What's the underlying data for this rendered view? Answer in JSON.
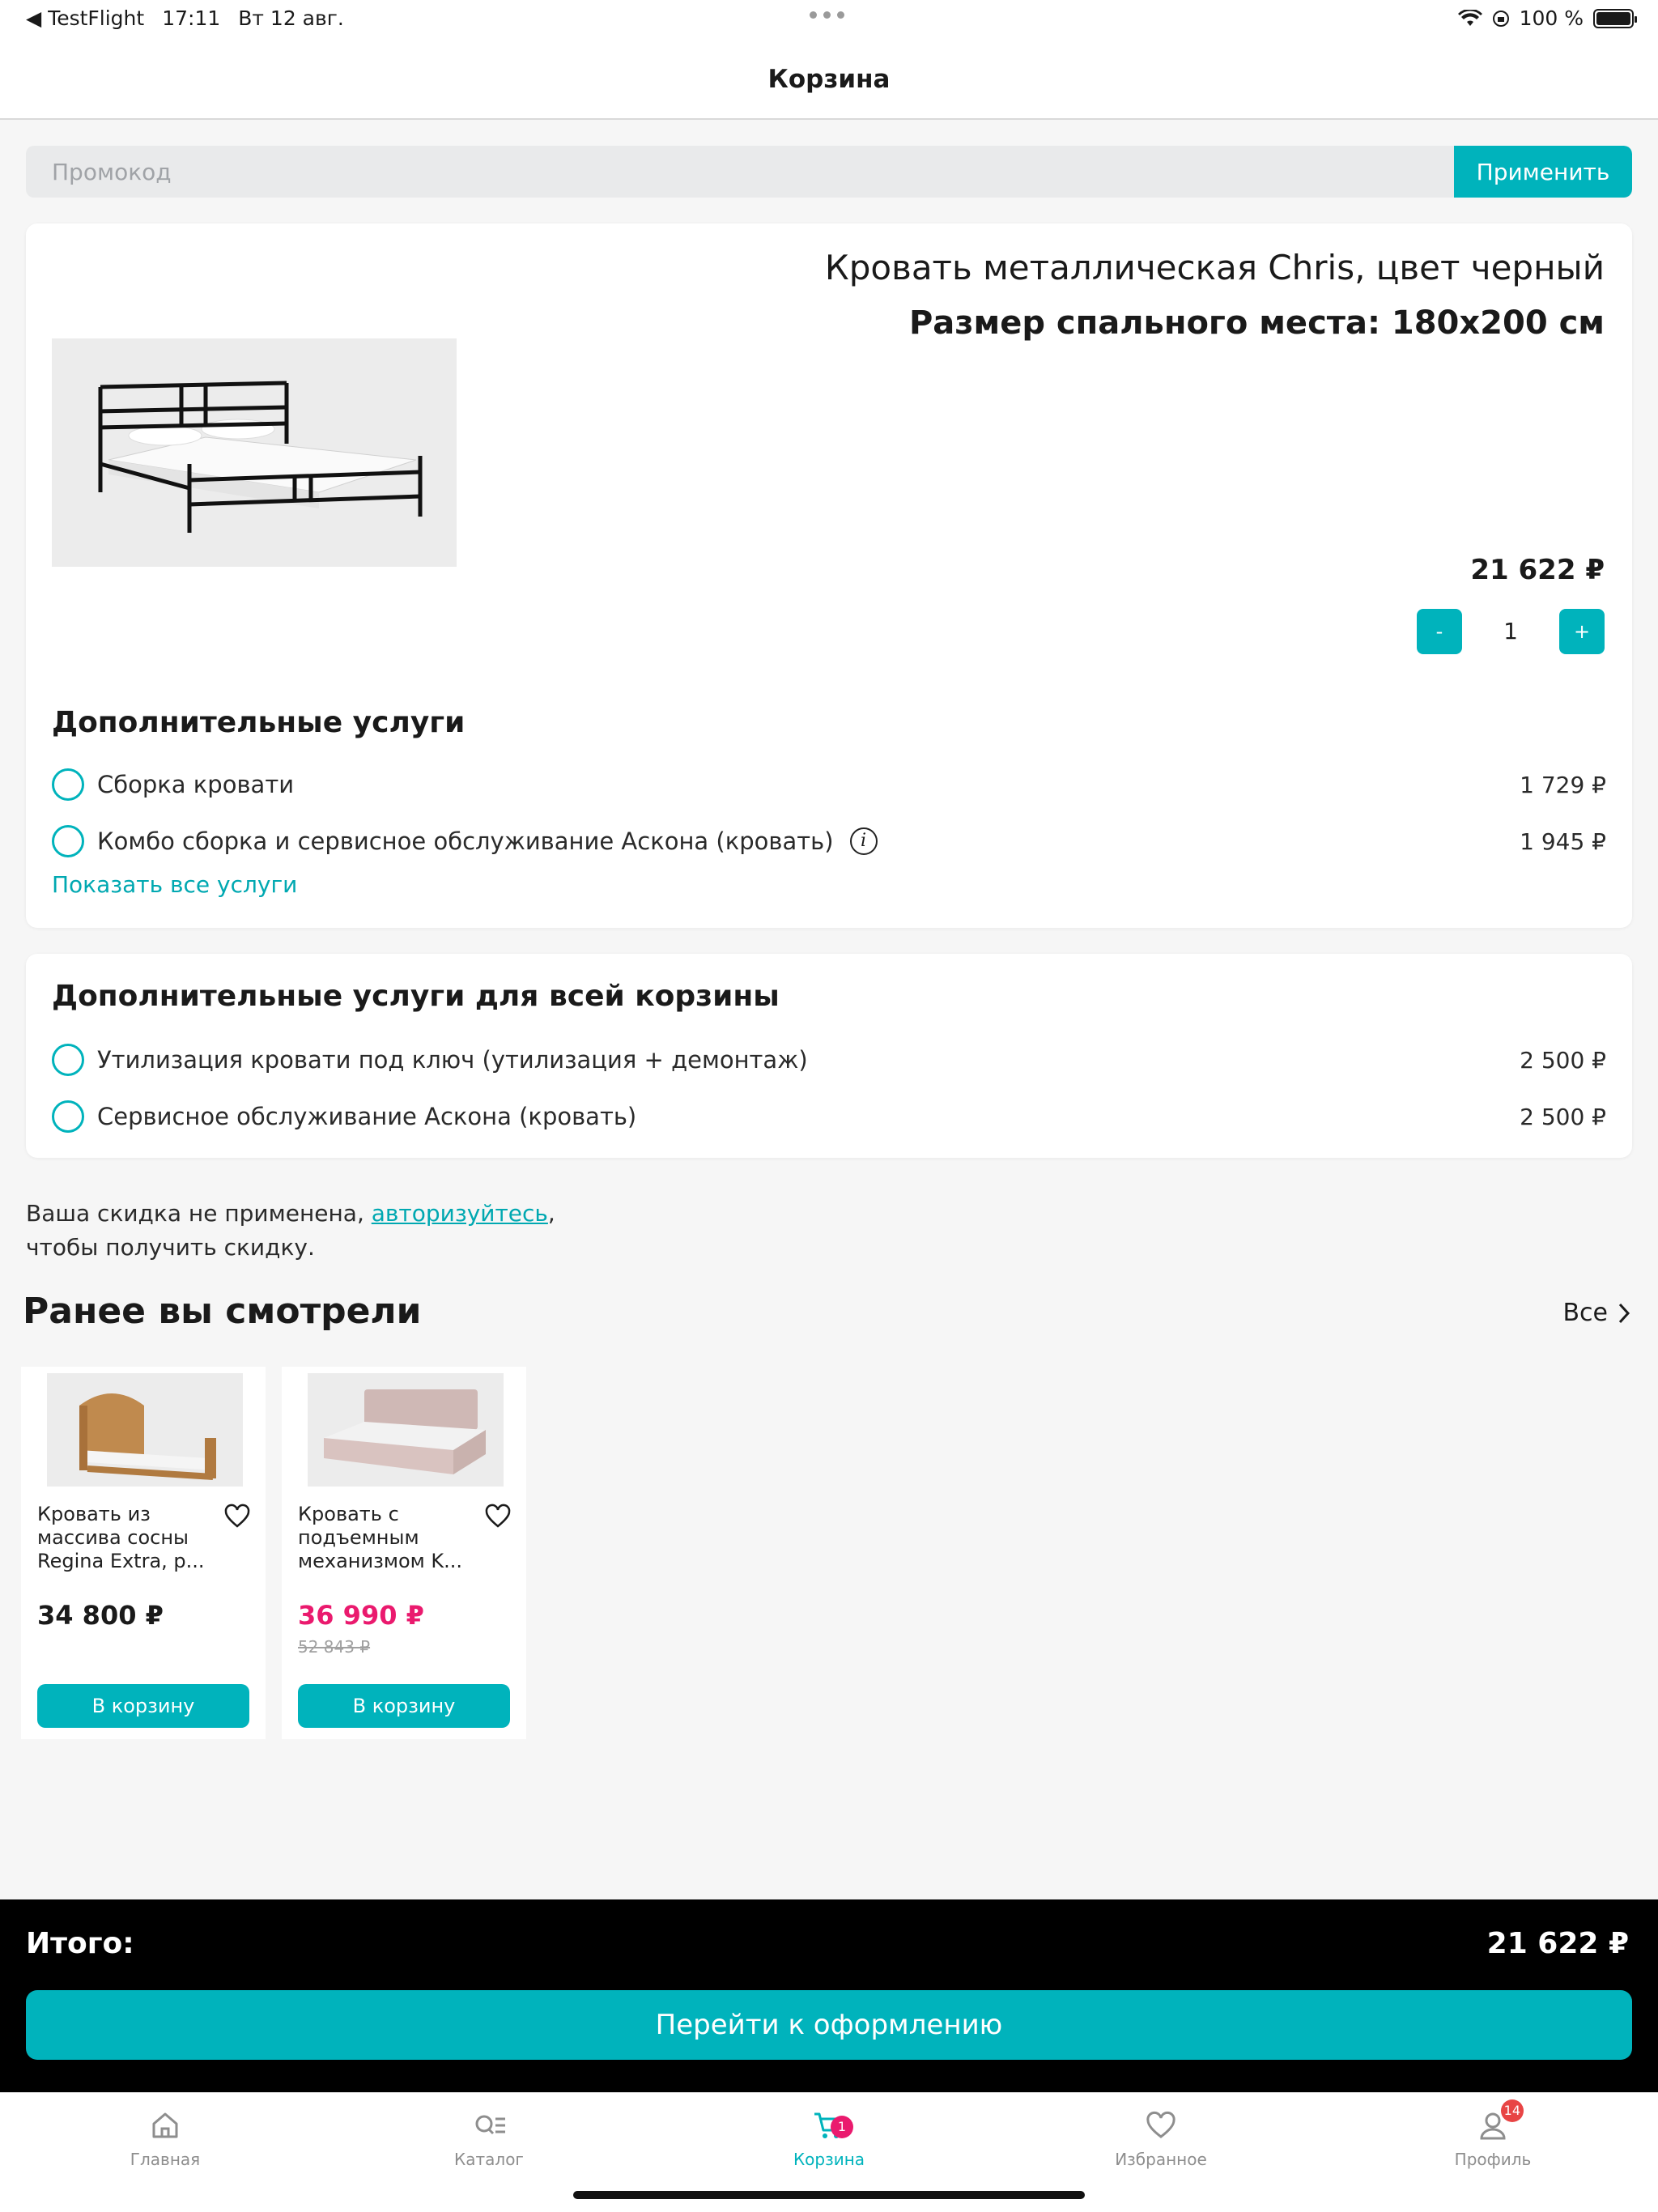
{
  "status": {
    "back_app": "◀ TestFlight",
    "time": "17:11",
    "date": "Вт 12 авг.",
    "battery": "100 %"
  },
  "header": {
    "title": "Корзина"
  },
  "promo": {
    "placeholder": "Промокод",
    "apply_label": "Применить"
  },
  "product": {
    "title": "Кровать металлическая Chris, цвет черный",
    "size": "Размер спального места: 180x200 см",
    "price": "21 622 ₽",
    "quantity": "1",
    "minus": "-",
    "plus": "+"
  },
  "services": {
    "title": "Дополнительные услуги",
    "items": [
      {
        "label": "Сборка кровати",
        "price": "1 729 ₽"
      },
      {
        "label": "Комбо сборка и сервисное обслуживание Аскона (кровать)",
        "price": "1 945 ₽"
      }
    ],
    "show_all": "Показать все услуги"
  },
  "cart_services": {
    "title": "Дополнительные услуги для всей корзины",
    "items": [
      {
        "label": "Утилизация кровати под ключ (утилизация + демонтаж)",
        "price": "2 500 ₽"
      },
      {
        "label": "Сервисное обслуживание Аскона (кровать)",
        "price": "2 500 ₽"
      }
    ]
  },
  "discount_notice": {
    "before": "Ваша скидка не применена, ",
    "link": "авторизуйтесь",
    "after_line1": ",",
    "line2": "чтобы получить скидку."
  },
  "recently_viewed": {
    "title": "Ранее вы смотрели",
    "all": "Все",
    "items": [
      {
        "name": "Кровать из массива сосны Regina Extra, р...",
        "price": "34 800 ₽",
        "old_price": "",
        "button": "В корзину"
      },
      {
        "name": "Кровать с подъемным механизмом K...",
        "price": "36 990 ₽",
        "old_price": "52 843 ₽",
        "button": "В корзину"
      }
    ]
  },
  "total": {
    "label": "Итого:",
    "value": "21 622 ₽",
    "checkout": "Перейти к оформлению"
  },
  "tabbar": {
    "tabs": [
      {
        "label": "Главная",
        "icon": "home-icon"
      },
      {
        "label": "Каталог",
        "icon": "catalog-icon"
      },
      {
        "label": "Корзина",
        "icon": "cart-icon",
        "badge": "1"
      },
      {
        "label": "Избранное",
        "icon": "heart-icon"
      },
      {
        "label": "Профиль",
        "icon": "profile-icon",
        "badge": "14"
      }
    ]
  },
  "colors": {
    "accent": "#00b3bc",
    "sale": "#ea1a6e",
    "badge_red": "#e84545",
    "dark": "#000000"
  }
}
